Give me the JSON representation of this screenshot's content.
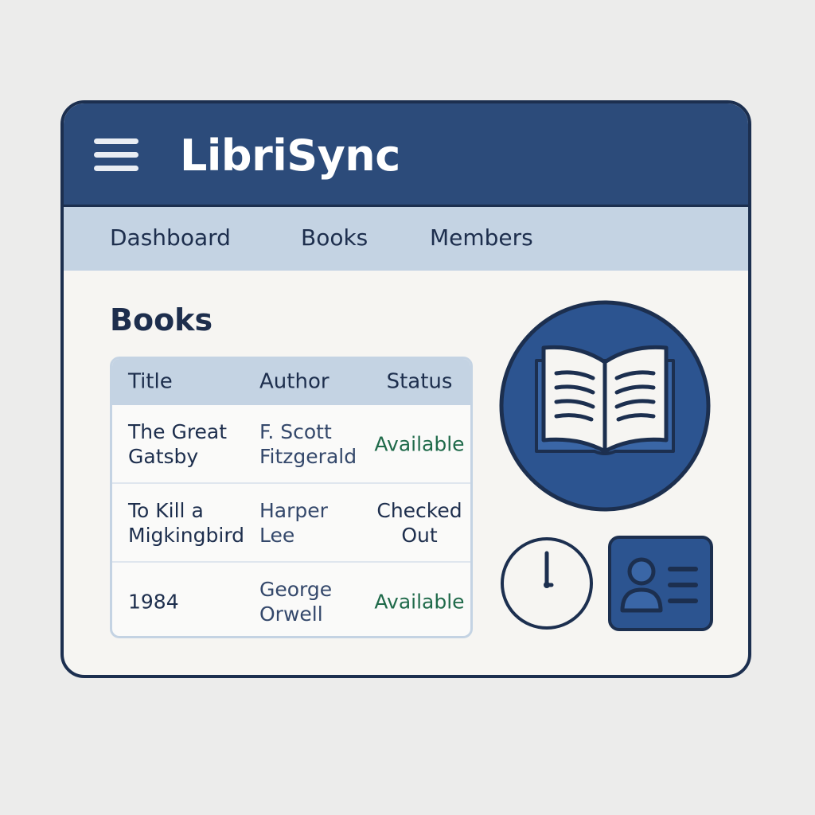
{
  "app": {
    "title": "LibriSync"
  },
  "nav": {
    "items": [
      "Dashboard",
      "Books",
      "Members"
    ]
  },
  "main": {
    "title": "Books",
    "table": {
      "headers": {
        "title": "Title",
        "author": "Author",
        "status": "Status"
      },
      "rows": [
        {
          "title": "The Great Gatsby",
          "author": "F. Scott Fitzgerald",
          "status": "Available"
        },
        {
          "title": "To Kill a Migkingbird",
          "author": "Harper Lee",
          "status": "Checked Out"
        },
        {
          "title": "1984",
          "author": "George Orwell",
          "status": "Available"
        }
      ]
    }
  },
  "icons": {
    "menu": "hamburger-menu-icon",
    "book": "open-book-icon",
    "clock": "clock-icon",
    "member": "member-id-card-icon"
  },
  "colors": {
    "header": "#2c4b7a",
    "nav": "#c4d3e3",
    "border": "#1c2f4f",
    "available": "#1f6a4a",
    "text": "#1d2e4d"
  }
}
